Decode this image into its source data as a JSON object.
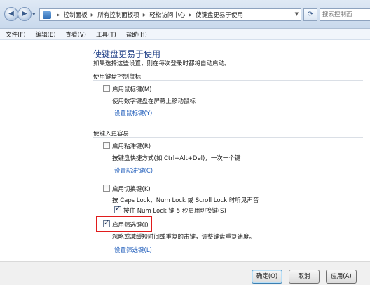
{
  "address_bar": {
    "breadcrumbs": [
      "控制面板",
      "所有控制面板项",
      "轻松访问中心",
      "使键盘更易于使用"
    ],
    "search_placeholder": "搜索控制面"
  },
  "menu": [
    "文件(F)",
    "编辑(E)",
    "查看(V)",
    "工具(T)",
    "帮助(H)"
  ],
  "page": {
    "title": "使键盘更易于使用",
    "subtitle": "如果选择这些设置，则在每次登录时都将自动启动。",
    "group_mouse": "使用键盘控制鼠标",
    "mouse_keys": {
      "label": "启用鼠标键(M)",
      "desc": "使用数字键盘在屏幕上移动鼠标",
      "link": "设置鼠标键(Y)",
      "checked": false
    },
    "group_typing": "使键入更容易",
    "sticky_keys": {
      "label": "启用粘滞键(R)",
      "desc": "按键盘快捷方式(如 Ctrl+Alt+Del)，一次一个键",
      "link": "设置粘滞键(C)",
      "checked": false
    },
    "toggle_keys": {
      "label": "启用切换键(K)",
      "desc": "按 Caps Lock、Num Lock 或 Scroll Lock 时听见声音",
      "sub_label": "按住 Num Lock 键 5 秒启用切换键(S)",
      "checked": false,
      "sub_checked": true
    },
    "filter_keys": {
      "label": "启用筛选键(I)",
      "desc": "忽略或减缓短时间或重复的击键，调整键盘重复速度。",
      "link": "设置筛选键(L)",
      "checked": true
    }
  },
  "buttons": {
    "ok": "确定(O)",
    "cancel": "取消",
    "apply": "应用(A)"
  },
  "colors": {
    "highlight_box": "#e01c1c",
    "link": "#1f5dbb",
    "title": "#1e3e86"
  }
}
